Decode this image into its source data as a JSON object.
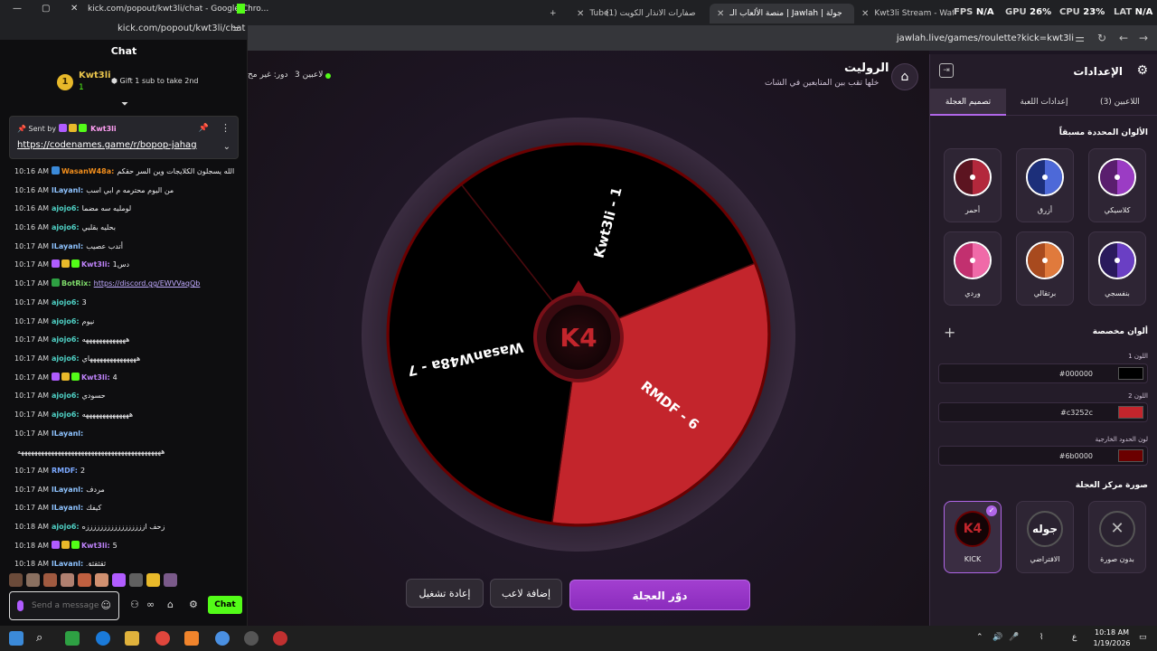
{
  "browser": {
    "tabs": [
      {
        "label": "kick.com/popout/kwt3li/chat - Google Chro...",
        "active": false
      },
      {
        "label": "Tube",
        "active": false
      },
      {
        "label": "(1) صفارات الانذار الكويت",
        "active": false
      },
      {
        "label": "منصة الألعاب الـ | Jawlah | جولة",
        "active": true
      },
      {
        "label": "Kwt3li Stream - Watch Live on",
        "active": false
      }
    ],
    "hud": {
      "fps_label": "FPS",
      "fps_value": "N/A",
      "gpu_label": "GPU",
      "gpu_value": "26%",
      "cpu_label": "CPU",
      "cpu_value": "23%",
      "lat_label": "LAT",
      "lat_value": "N/A"
    },
    "url": "jawlah.live/games/roulette?kick=kwt3li"
  },
  "chat": {
    "window_title": "kick.com/popout/kwt3li/chat - Google Chro...",
    "url": "kick.com/popout/kwt3li/chat",
    "header": "Chat",
    "gift": {
      "medal": "1",
      "user": "Kwt3li",
      "count": "1",
      "text": "Gift 1 sub to take 2nd"
    },
    "pinned": {
      "sent_by": "Sent by",
      "user": "Kwt3li",
      "link": "https://codenames.game/r/bopop-jahag"
    },
    "messages": [
      {
        "time": "10:16 AM",
        "user": "WasanW48a:",
        "text": "الله يسجلون الكلايجات وين السر حقكم",
        "color": "#f28e1c"
      },
      {
        "time": "10:16 AM",
        "user": "lLayanl:",
        "text": "من اليوم محترمه م ابي اسب",
        "color": "#8ec3ff"
      },
      {
        "time": "10:16 AM",
        "user": "ajojo6:",
        "text": "لومليه سه مضما",
        "color": "#4fd1c5"
      },
      {
        "time": "10:16 AM",
        "user": "ajojo6:",
        "text": "بحليه بقلبي",
        "color": "#4fd1c5"
      },
      {
        "time": "10:17 AM",
        "user": "lLayanl:",
        "text": "أتدب عصيب",
        "color": "#8ec3ff"
      },
      {
        "time": "10:17 AM",
        "user": "Kwt3li:",
        "text": "دس1",
        "color": "#c084fc"
      },
      {
        "time": "10:17 AM",
        "user": "BotRix:",
        "text": "https://discord.gg/EWVVaqQb",
        "color": "#7fdc6a",
        "link": true
      },
      {
        "time": "10:17 AM",
        "user": "ajojo6:",
        "text": "3",
        "color": "#4fd1c5"
      },
      {
        "time": "10:17 AM",
        "user": "ajojo6:",
        "text": "نيوم",
        "color": "#4fd1c5"
      },
      {
        "time": "10:17 AM",
        "user": "ajojo6:",
        "text": "هههههههههههههه",
        "color": "#4fd1c5"
      },
      {
        "time": "10:17 AM",
        "user": "ajojo6:",
        "text": "هههههههههههههههاي",
        "color": "#4fd1c5"
      },
      {
        "time": "10:17 AM",
        "user": "Kwt3li:",
        "text": "4",
        "color": "#c084fc"
      },
      {
        "time": "10:17 AM",
        "user": "ajojo6:",
        "text": "حسودي",
        "color": "#4fd1c5"
      },
      {
        "time": "10:17 AM",
        "user": "ajojo6:",
        "text": "ههههههههههههههه",
        "color": "#4fd1c5"
      },
      {
        "time": "10:17 AM",
        "user": "lLayanl:",
        "text": "",
        "color": "#8ec3ff"
      },
      {
        "time": "",
        "user": "",
        "text": "هههههههههههههههههههههههههههههههههههههههههههه",
        "color": "#efeff1"
      },
      {
        "time": "10:17 AM",
        "user": "RMDF:",
        "text": "2",
        "color": "#7aa8ff"
      },
      {
        "time": "10:17 AM",
        "user": "lLayanl:",
        "text": "مردف",
        "color": "#8ec3ff"
      },
      {
        "time": "10:17 AM",
        "user": "lLayanl:",
        "text": "كيفك",
        "color": "#8ec3ff"
      },
      {
        "time": "10:18 AM",
        "user": "ajojo6:",
        "text": "زحف ازززززززززززززززززه",
        "color": "#4fd1c5"
      },
      {
        "time": "10:18 AM",
        "user": "Kwt3li:",
        "text": "5",
        "color": "#c084fc"
      },
      {
        "time": "10:18 AM",
        "user": "lLayanl:",
        "text": "ثقثقثق",
        "color": "#8ec3ff"
      }
    ],
    "input_placeholder": "Send a message",
    "send_label": "Chat"
  },
  "app": {
    "title": "الروليت",
    "subtitle": "خلها تقب بين المتابعين في الشات",
    "players_meta": "3 لاعبين",
    "status_meta": "دور: غير مح",
    "wheel": {
      "center_text": "K4",
      "segments": [
        {
          "label": "Kwt3li - 1",
          "color": "#000000"
        },
        {
          "label": "RMDF - 6",
          "color": "#c3252c"
        },
        {
          "label": "WasanW48a - 7",
          "color": "#000000"
        }
      ]
    },
    "buttons": {
      "restart": "إعادة تشغيل",
      "add_player": "إضافة لاعب",
      "spin": "دوّر العجلة"
    }
  },
  "panel": {
    "title": "الإعدادات",
    "tabs": [
      {
        "label": "اللاعبين (3)",
        "active": false
      },
      {
        "label": "إعدادات اللعبة",
        "active": false
      },
      {
        "label": "تصميم العجلة",
        "active": true
      }
    ],
    "presets_title": "الألوان المحددة مسبقاً",
    "presets": [
      {
        "label": "كلاسيكي",
        "c1": "#5a1e6e",
        "c2": "#9b3cc4"
      },
      {
        "label": "أزرق",
        "c1": "#1c2f7a",
        "c2": "#4d69d8"
      },
      {
        "label": "أحمر",
        "c1": "#5c1420",
        "c2": "#b3283c"
      },
      {
        "label": "بنفسجي",
        "c1": "#2a1a5c",
        "c2": "#6a3fc4"
      },
      {
        "label": "برتقالي",
        "c1": "#a84a1e",
        "c2": "#e07a3c"
      },
      {
        "label": "وردي",
        "c1": "#c2306f",
        "c2": "#f06aa8"
      }
    ],
    "custom_title": "ألوان مخصصة",
    "fields": [
      {
        "label": "اللون 1",
        "value": "#000000",
        "swatch": "#000000"
      },
      {
        "label": "اللون 2",
        "value": "#c3252c",
        "swatch": "#c3252c"
      },
      {
        "label": "لون الحدود الخارجية",
        "value": "#6b0000",
        "swatch": "#6b0000"
      }
    ],
    "center_image_title": "صورة مركز العجلة",
    "center_images": [
      {
        "label": "بدون صورة",
        "glyph": "✕"
      },
      {
        "label": "الافتراضي",
        "glyph": "جوله"
      },
      {
        "label": "KICK",
        "glyph": "K4",
        "selected": true
      }
    ]
  },
  "taskbar": {
    "time": "10:18 AM",
    "date": "1/19/2026",
    "lang": "ع"
  }
}
